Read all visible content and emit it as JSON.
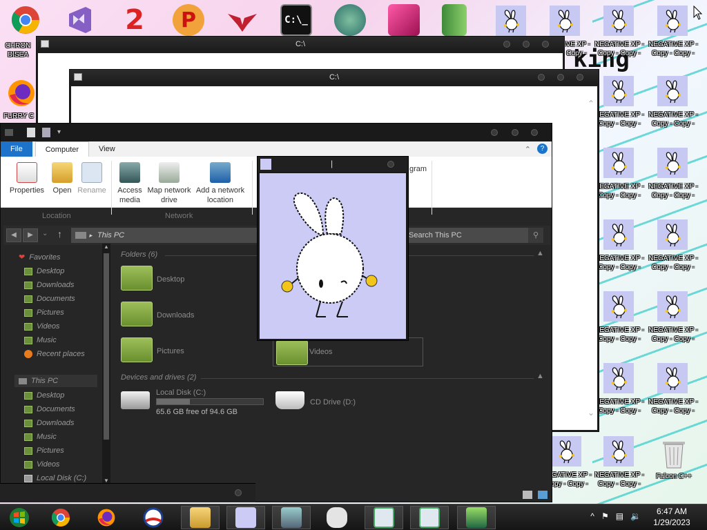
{
  "desktop": {
    "top_icons": [
      {
        "name": "chrome",
        "label": "CHRON DISEA"
      },
      {
        "name": "visual-studio"
      },
      {
        "name": "question-2"
      },
      {
        "name": "p-logo"
      },
      {
        "name": "winged-heart"
      },
      {
        "name": "cmd"
      },
      {
        "name": "globe-santa"
      },
      {
        "name": "pink-app"
      },
      {
        "name": "green-book"
      }
    ],
    "left_icons": [
      {
        "name": "chrome",
        "label": "CHRON\nDISEA"
      },
      {
        "name": "firefox",
        "label": "FURRY C"
      }
    ],
    "bunny_label_line1": "NEGATIVE XP -",
    "bunny_label_line2": "Copy - Copy -",
    "recycle_bin_label": "Falcon C++",
    "background_text": "king"
  },
  "cmd_windows": [
    {
      "title": "C:\\"
    },
    {
      "title": "C:\\"
    }
  ],
  "explorer": {
    "tabs": {
      "file": "File",
      "computer": "Computer",
      "view": "View"
    },
    "ribbon": {
      "properties": "Properties",
      "open": "Open",
      "rename": "Rename",
      "access_media": "Access\nmedia",
      "map_network": "Map network\ndrive",
      "add_network": "Add a network\nlocation",
      "program": "gram",
      "group_location": "Location",
      "group_network": "Network"
    },
    "address": "This PC",
    "search_placeholder": "Search This PC",
    "nav": {
      "favorites": "Favorites",
      "fav_items": [
        "Desktop",
        "Downloads",
        "Documents",
        "Pictures",
        "Videos",
        "Music",
        "Recent places"
      ],
      "this_pc": "This PC",
      "pc_items": [
        "Desktop",
        "Documents",
        "Downloads",
        "Music",
        "Pictures",
        "Videos",
        "Local Disk (C:)"
      ]
    },
    "folders_header": "Folders (6)",
    "folders": [
      "Desktop",
      "Downloads",
      "Pictures",
      "Videos"
    ],
    "devices_header": "Devices and drives (2)",
    "drive_c": {
      "name": "Local Disk (C:)",
      "free": "65.6 GB free of 94.6 GB",
      "used_fraction": 0.31
    },
    "drive_d": {
      "name": "CD Drive (D:)"
    }
  },
  "viewer": {
    "title": "|"
  },
  "taskbar": {
    "items": [
      "start",
      "chrome",
      "firefox",
      "obama-app",
      "file-explorer",
      "bunny-viewer",
      "photo-viewer",
      "game-controller",
      "window-app-1",
      "window-app-2",
      "green-app"
    ],
    "time": "6:47 AM",
    "date": "1/29/2023",
    "tray_up": "^"
  }
}
